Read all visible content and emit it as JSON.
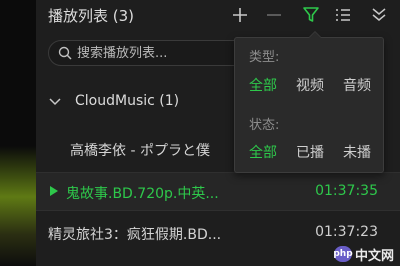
{
  "header": {
    "title": "播放列表 (3)",
    "icons": [
      "plus-icon",
      "minus-icon",
      "filter-icon",
      "list-menu-icon",
      "double-chevron-down-icon"
    ]
  },
  "search": {
    "placeholder": "搜索播放列表..."
  },
  "group": {
    "label": "CloudMusic  (1)"
  },
  "items": [
    {
      "name": "高橋李依 - ポプラと僕",
      "time": ""
    },
    {
      "name": "鬼故事.BD.720p.中英...",
      "time": "01:37:35",
      "playing": true
    },
    {
      "name": "精灵旅社3：疯狂假期.BD...",
      "time": "01:37:23"
    }
  ],
  "filter_menu": {
    "type_label": "类型:",
    "type_options": [
      "全部",
      "视频",
      "音频"
    ],
    "status_label": "状态:",
    "status_options": [
      "全部",
      "已播",
      "未播"
    ]
  },
  "watermark": {
    "badge": "php",
    "text": "中文网"
  },
  "colors": {
    "accent": "#2ec84b",
    "panel_bg": "#1e1e1e"
  }
}
